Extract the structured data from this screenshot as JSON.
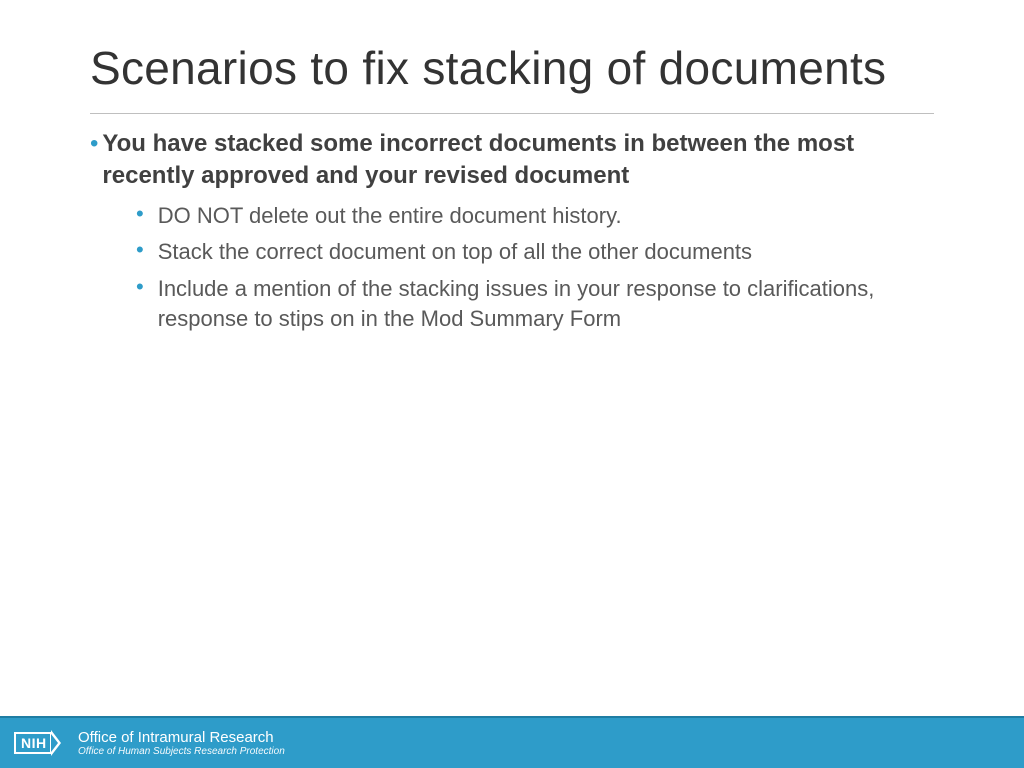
{
  "slide": {
    "title": "Scenarios to fix stacking of documents",
    "top_bullet": {
      "text": "You have stacked some incorrect documents in between the most recently approved and your revised document"
    },
    "sub_bullets": [
      "DO NOT delete out the entire document history.",
      "Stack the correct document on top of all the other documents",
      "Include a mention of the stacking issues in your response to clarifications, response to stips on in the Mod Summary Form"
    ]
  },
  "footer": {
    "logo_text": "NIH",
    "line1": "Office of Intramural Research",
    "line2": "Office of Human Subjects Research Protection"
  }
}
